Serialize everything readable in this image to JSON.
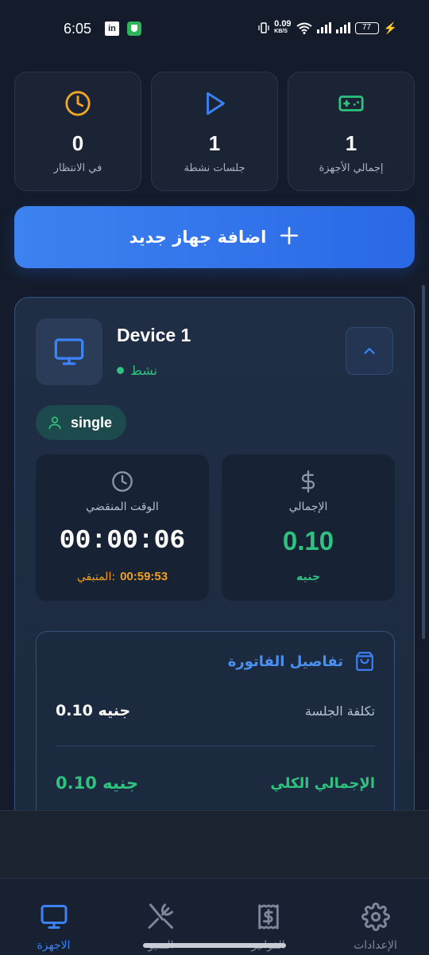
{
  "status_bar": {
    "time": "6:05",
    "linkedin_label": "in",
    "net_speed": "0.09",
    "net_unit": "KB/S",
    "battery": "77"
  },
  "stats": [
    {
      "value": "1",
      "label": "إجمالي الأجهزة",
      "icon": "gamepad-icon",
      "color": "#2ec27e"
    },
    {
      "value": "1",
      "label": "جلسات نشطة",
      "icon": "play-icon",
      "color": "#3b82f6"
    },
    {
      "value": "0",
      "label": "في الانتظار",
      "icon": "clock-icon",
      "color": "#f5a623"
    }
  ],
  "add_device": {
    "label": "اضافة جهاز جديد"
  },
  "device": {
    "name": "Device 1",
    "status": "نشط",
    "session_type": "single",
    "elapsed_label": "الوقت المنقضي",
    "elapsed_value": "00:00:06",
    "remaining_label": "المتبقي:",
    "remaining_value": "00:59:53",
    "total_label": "الإجمالي",
    "total_value": "0.10",
    "currency": "جنيه"
  },
  "invoice": {
    "title": "تفاصيل الفاتورة",
    "session_cost_label": "تكلفة الجلسة",
    "session_cost_value": "0.10 جنيه",
    "grand_total_label": "الإجمالي الكلي",
    "grand_total_value": "0.10 جنيه"
  },
  "nav": [
    {
      "label": "الاجهزة",
      "icon": "monitor-icon",
      "active": true
    },
    {
      "label": "المنيو",
      "icon": "utensils-icon",
      "active": false
    },
    {
      "label": "الفواتير",
      "icon": "receipt-icon",
      "active": false
    },
    {
      "label": "الإعدادات",
      "icon": "gear-icon",
      "active": false
    }
  ],
  "colors": {
    "accent": "#3b82f6",
    "success": "#2ec27e",
    "warning": "#f5a623",
    "background": "#141c2b"
  }
}
